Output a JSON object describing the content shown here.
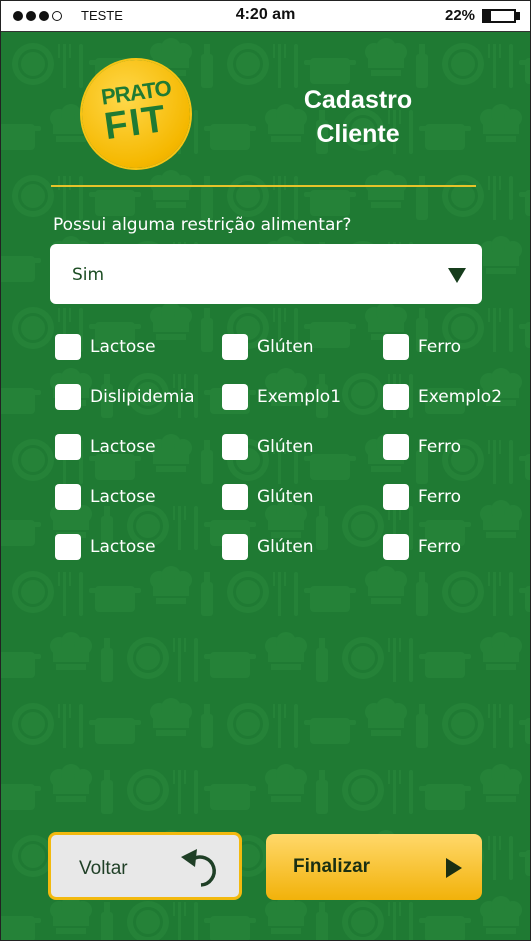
{
  "status_bar": {
    "carrier": "TESTE",
    "time": "4:20 am",
    "battery_percent": "22%",
    "battery_level": 0.22
  },
  "logo": {
    "line1": "PRATO",
    "line2": "FIT"
  },
  "header": {
    "title_line1": "Cadastro",
    "title_line2": "Cliente"
  },
  "form": {
    "question": "Possui alguma restrição alimentar?",
    "select_value": "Sim",
    "options": [
      [
        "Lactose",
        "Glúten",
        "Ferro"
      ],
      [
        "Dislipidemia",
        "Exemplo1",
        "Exemplo2"
      ],
      [
        "Lactose",
        "Glúten",
        "Ferro"
      ],
      [
        "Lactose",
        "Glúten",
        "Ferro"
      ],
      [
        "Lactose",
        "Glúten",
        "Ferro"
      ]
    ]
  },
  "buttons": {
    "back": "Voltar",
    "finish": "Finalizar"
  },
  "colors": {
    "background": "#1f7a33",
    "accent": "#f2b90e",
    "divider": "#e6c32a"
  }
}
